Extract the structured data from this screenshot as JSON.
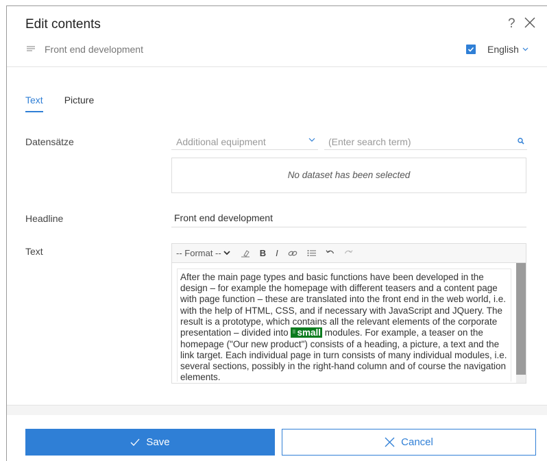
{
  "dialog": {
    "title": "Edit contents",
    "help": "?",
    "subtitle": "Front end development",
    "language": "English"
  },
  "tabs": [
    {
      "label": "Text",
      "active": true
    },
    {
      "label": "Picture",
      "active": false
    }
  ],
  "datasets": {
    "label": "Datensätze",
    "select_value": "Additional equipment",
    "search_placeholder": "(Enter search term)",
    "empty_text": "No dataset has been selected"
  },
  "headline": {
    "label": "Headline",
    "value": "Front end development"
  },
  "text_field": {
    "label": "Text",
    "format_label": "-- Format --",
    "bold": "B",
    "italic": "I",
    "body_before": "After the main page types and basic functions have been developed in the design – for example the homepage with different teasers and a content page with page function – these are translated into the front end in the web world, i.e. with the help of HTML, CSS, and if necessary with JavaScript and JQuery. The result is a prototype, which contains all the relevant elements of the corporate presentation – divided into ",
    "highlight": "small",
    "body_after": " modules. For example, a teaser on the homepage (\"Our new product\") consists of a heading, a picture, a text and the link target. Each individual page in turn consists of many individual modules, i.e. several sections, possibly in the right-hand column and of course the navigation elements."
  },
  "actions": {
    "save": "Save",
    "cancel": "Cancel"
  },
  "colors": {
    "accent": "#2f7fd6",
    "highlight": "#0a7a1d"
  }
}
